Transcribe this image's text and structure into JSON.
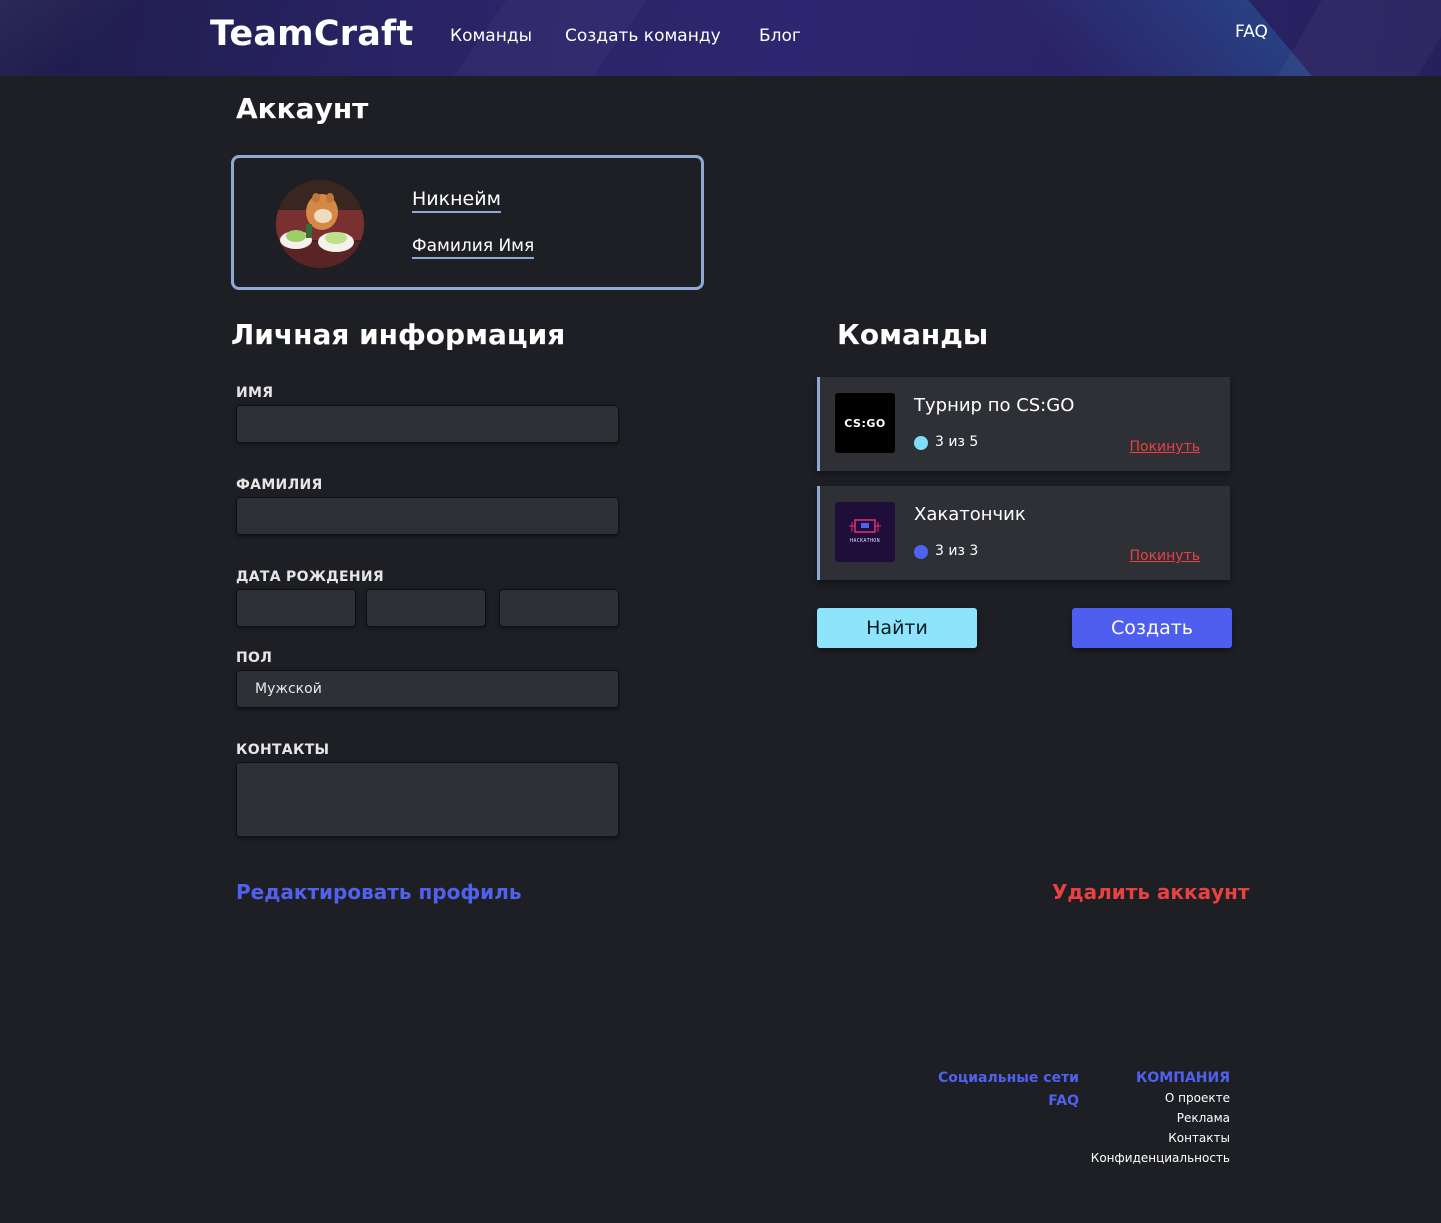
{
  "header": {
    "logo": "TeamCraft",
    "nav": [
      "Команды",
      "Создать команду",
      "Блог"
    ],
    "faq": "FAQ"
  },
  "account": {
    "title": "Аккаунт",
    "nickname": "Никнейм",
    "fullname": "Фамилия Имя"
  },
  "personal": {
    "title": "Личная информация",
    "first_name_label": "ИМЯ",
    "first_name_value": "",
    "last_name_label": "ФАМИЛИЯ",
    "last_name_value": "",
    "birthdate_label": "ДАТА РОЖДЕНИЯ",
    "birthdate_day": "",
    "birthdate_month": "",
    "birthdate_year": "",
    "gender_label": "ПОЛ",
    "gender_value": "Мужской",
    "contacts_label": "КОНТАКТЫ",
    "contacts_value": ""
  },
  "actions": {
    "edit": "Редактировать профиль",
    "delete": "Удалить аккаунт"
  },
  "teams": {
    "title": "Команды",
    "items": [
      {
        "name": "Турнир по CS:GO",
        "count": "3 из 5",
        "leave": "Покинуть",
        "dot_color": "#7fdcf5",
        "logo_text": "CS:GO"
      },
      {
        "name": "Хакатончик",
        "count": "3 из 3",
        "leave": "Покинуть",
        "dot_color": "#4e62f0",
        "logo_text": "HACKATHON"
      }
    ],
    "find_button": "Найти",
    "create_button": "Создать"
  },
  "footer": {
    "social": "Социальные сети",
    "faq": "FAQ",
    "company": "КОМПАНИЯ",
    "company_links": [
      "О проекте",
      "Реклама",
      "Контакты",
      "Конфиденциальность"
    ]
  },
  "colors": {
    "accent_blue": "#5061ee",
    "danger": "#e94040",
    "find_button_bg": "#8ee4fb",
    "create_button_bg": "#4e5ff0",
    "card_border": "#8eaad4"
  }
}
